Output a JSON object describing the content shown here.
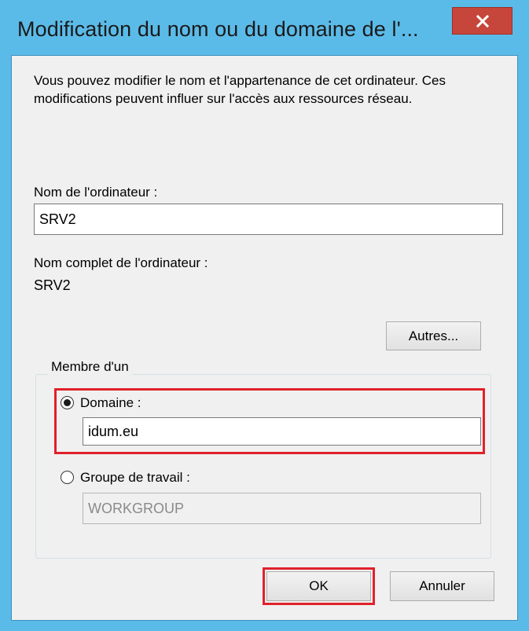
{
  "window": {
    "title": "Modification du nom ou du domaine de l'..."
  },
  "intro_text": "Vous pouvez modifier le nom et l'appartenance de cet ordinateur. Ces modifications peuvent influer sur l'accès aux ressources réseau.",
  "computer_name": {
    "label": "Nom de l'ordinateur :",
    "value": "SRV2"
  },
  "full_name": {
    "label": "Nom complet de l'ordinateur :",
    "value": "SRV2"
  },
  "more_button": "Autres...",
  "member_of": {
    "legend": "Membre d'un",
    "domain": {
      "label": "Domaine :",
      "value": "idum.eu",
      "selected": true
    },
    "workgroup": {
      "label": "Groupe de travail :",
      "value": "WORKGROUP",
      "selected": false
    }
  },
  "buttons": {
    "ok": "OK",
    "cancel": "Annuler"
  },
  "colors": {
    "frame": "#5bbbe8",
    "close": "#c7463b",
    "highlight": "#e0212b"
  }
}
